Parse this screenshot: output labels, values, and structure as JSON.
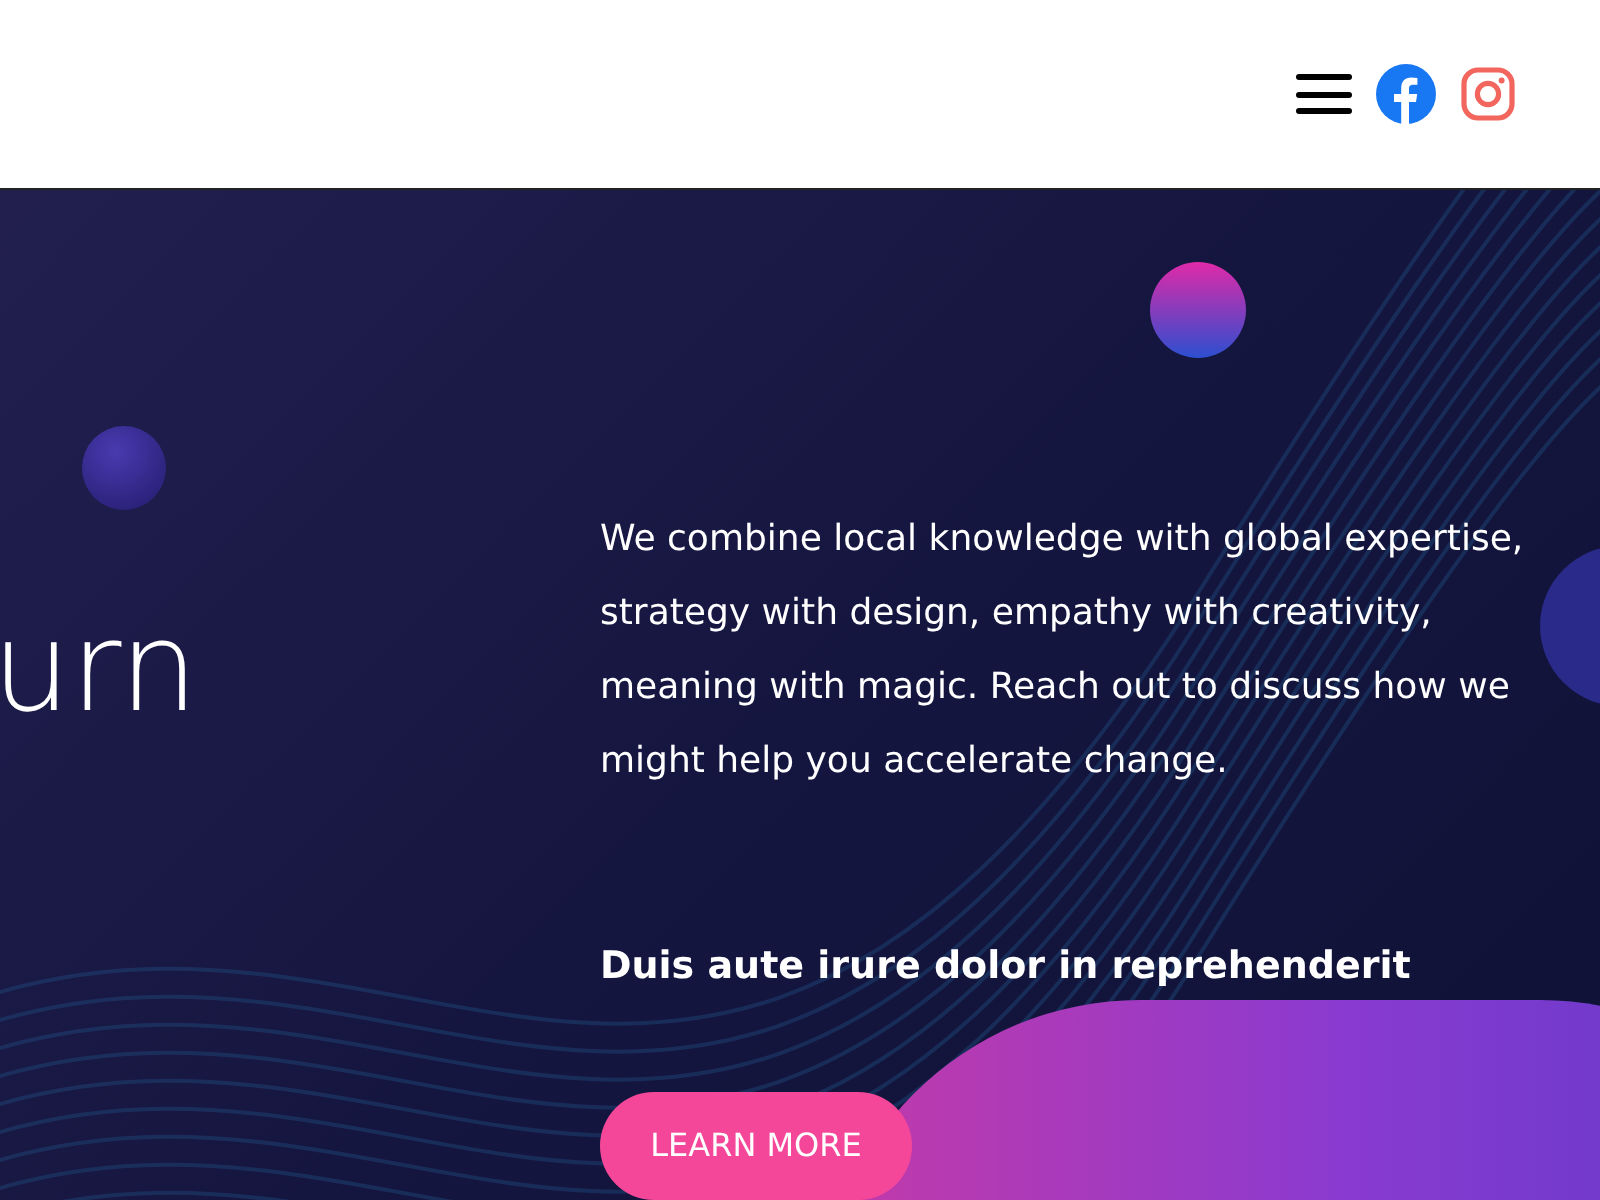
{
  "header": {
    "icons": [
      {
        "kind": "menu"
      },
      {
        "kind": "facebook"
      },
      {
        "kind": "instagram"
      }
    ]
  },
  "hero": {
    "heading_fragment": "urn",
    "paragraph": "We combine local knowledge with global expertise, strategy with design, empathy with creativity, meaning with magic. Reach out to discuss how we might help you accelerate change.",
    "subheading": "Duis aute irure dolor in reprehenderit",
    "button": "LEARN MORE"
  }
}
